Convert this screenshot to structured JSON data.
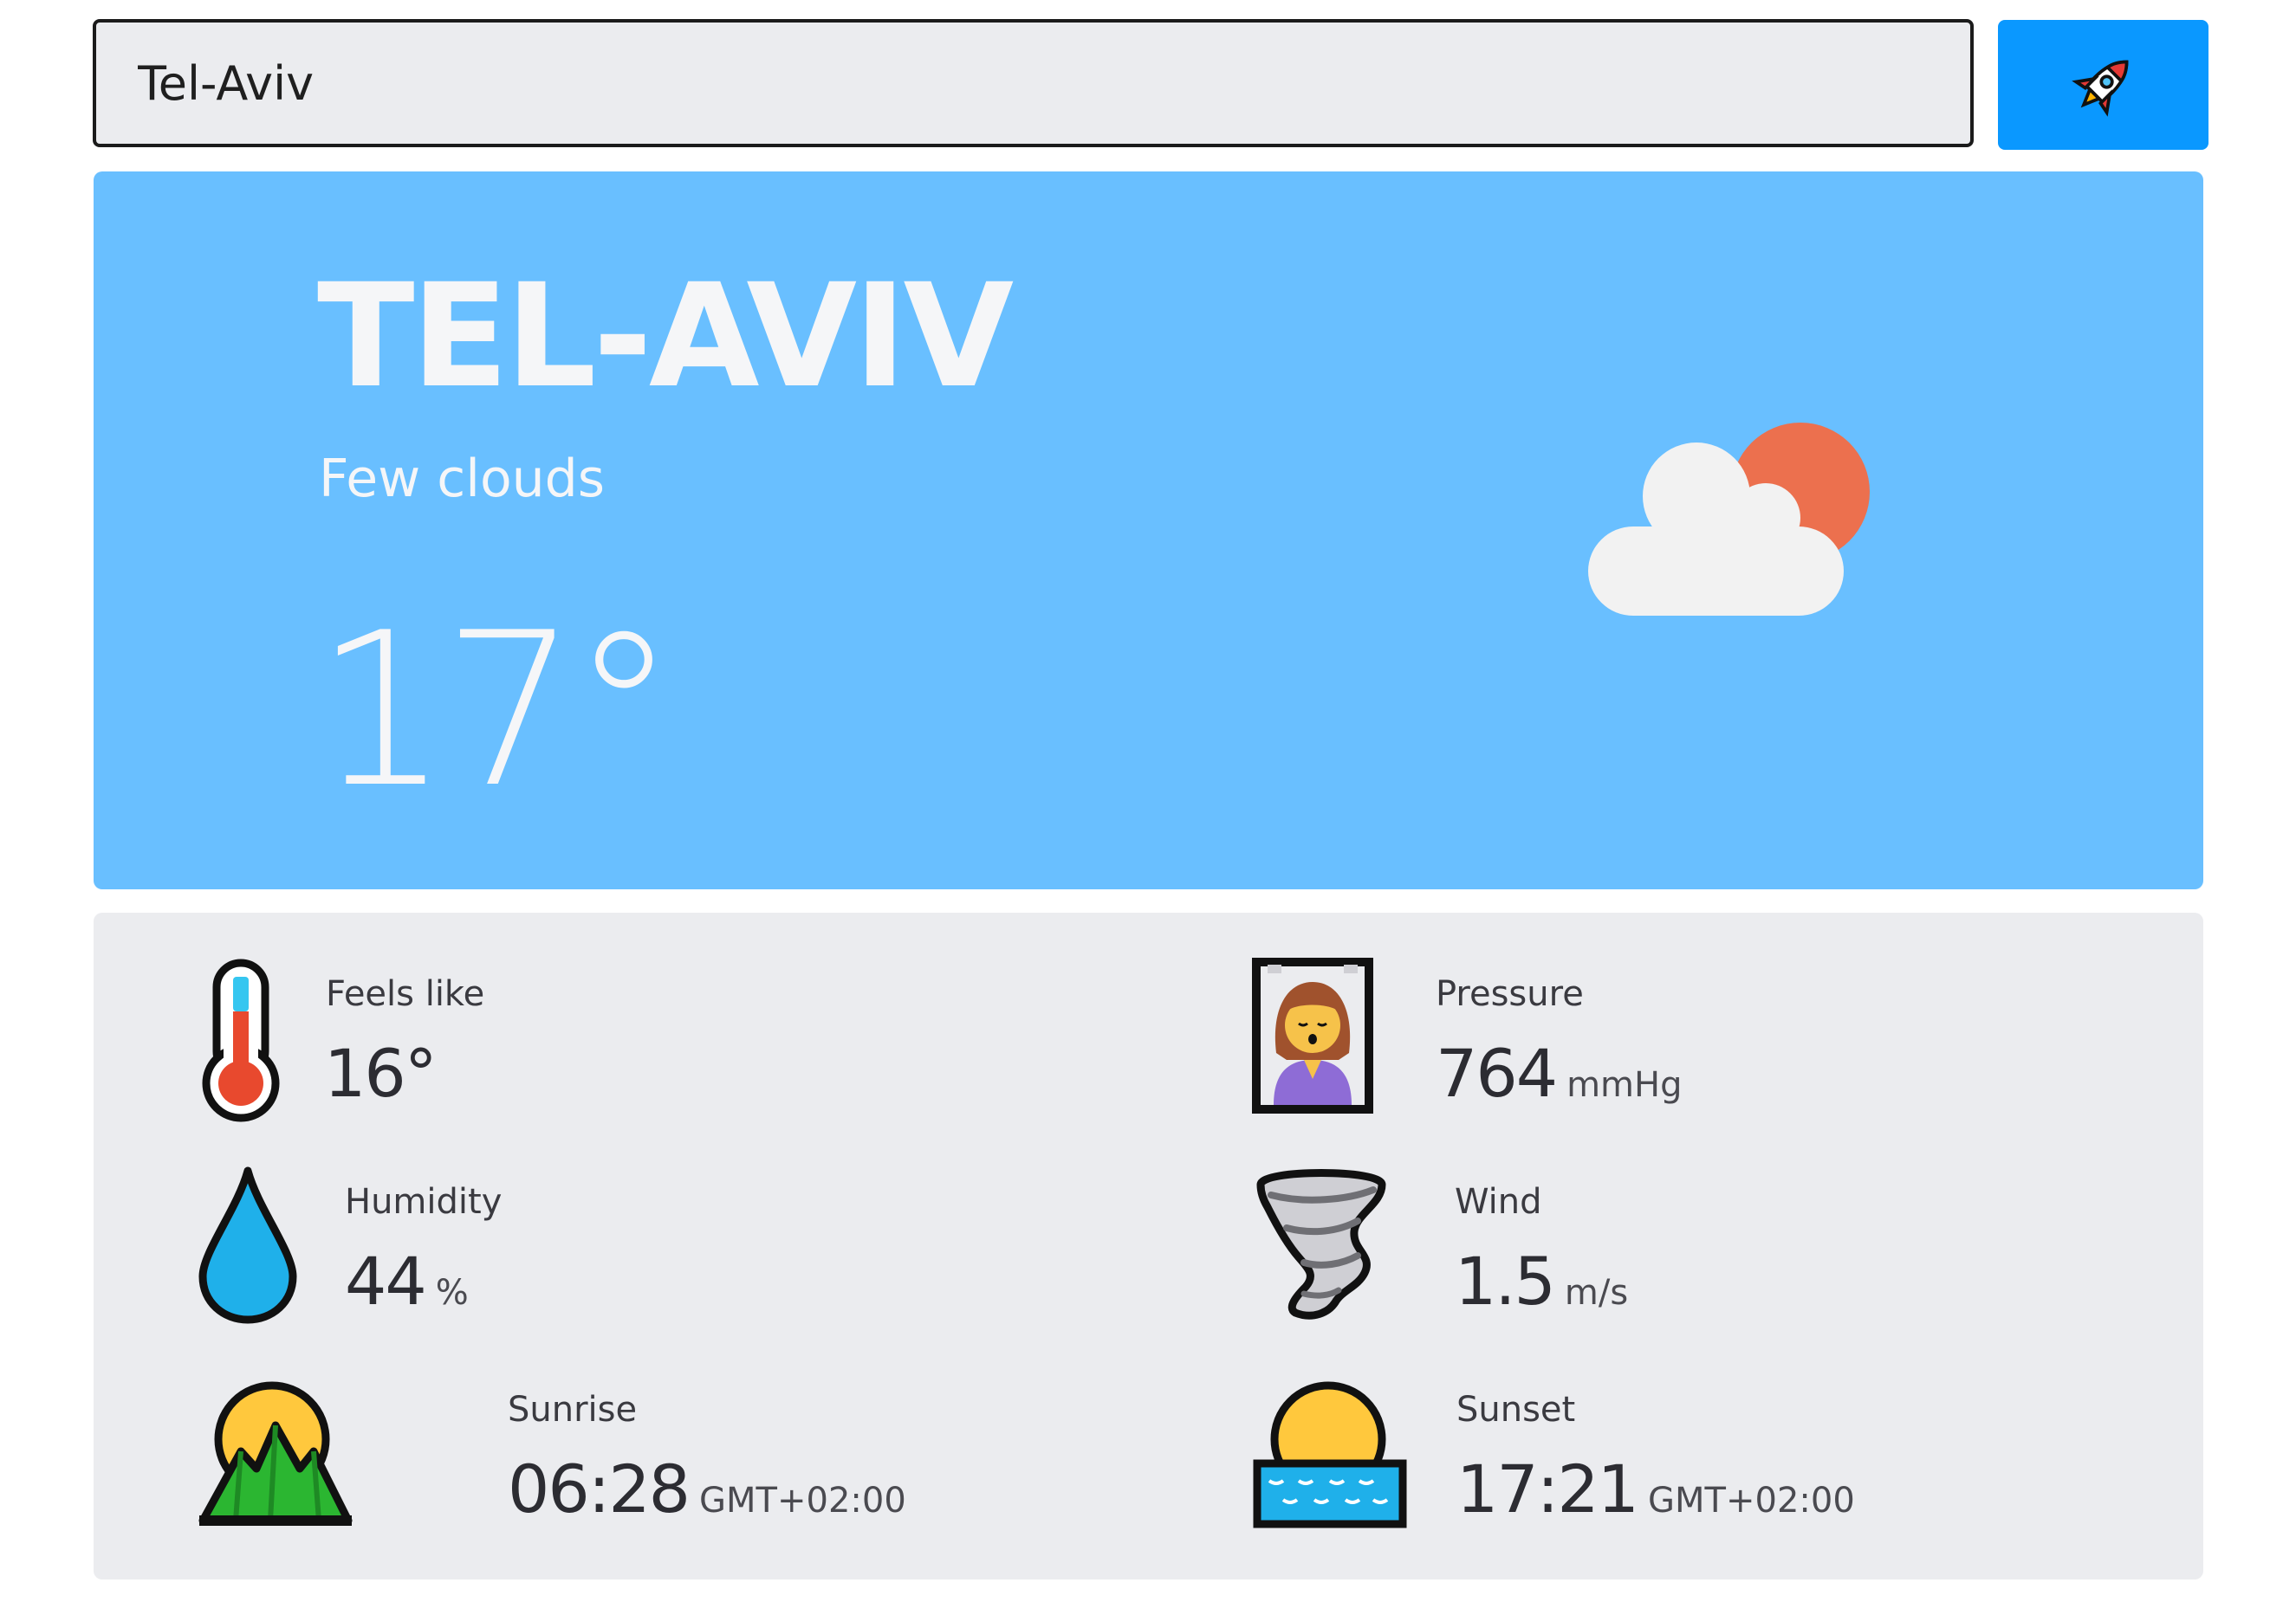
{
  "search": {
    "value": "Tel-Aviv"
  },
  "button": {
    "icon": "rocket-icon",
    "color": "#0a98ff"
  },
  "current": {
    "city": "TEL-AVIV",
    "description": "Few clouds",
    "temperature": "17°",
    "icon": "cloud-sun-icon",
    "card_color": "#69bfff"
  },
  "details": {
    "feels_like": {
      "label": "Feels like",
      "value": "16°",
      "unit": "",
      "icon": "thermometer-icon"
    },
    "pressure": {
      "label": "Pressure",
      "value": "764",
      "unit": "mmHg",
      "icon": "person-in-steam-room-icon"
    },
    "humidity": {
      "label": "Humidity",
      "value": "44",
      "unit": "%",
      "icon": "droplet-icon"
    },
    "wind": {
      "label": "Wind",
      "value": "1.5",
      "unit": "m/s",
      "icon": "tornado-icon"
    },
    "sunrise": {
      "label": "Sunrise",
      "value": "06:28",
      "unit": "GMT+02:00",
      "icon": "sunrise-over-mountains-icon"
    },
    "sunset": {
      "label": "Sunset",
      "value": "17:21",
      "unit": "GMT+02:00",
      "icon": "sunset-over-water-icon"
    }
  }
}
